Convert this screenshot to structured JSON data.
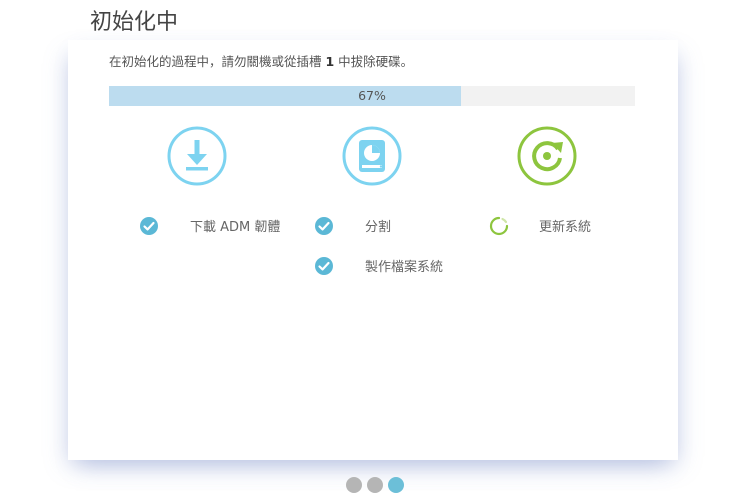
{
  "page": {
    "title": "初始化中",
    "description_pre": "在初始化的過程中，請勿關機或從插槽 ",
    "description_num": "1",
    "description_post": " 中拔除硬碟。"
  },
  "progress": {
    "percent": 67,
    "label": "67%"
  },
  "stages": [
    {
      "icon": "download-icon",
      "color": "#7dd3f0"
    },
    {
      "icon": "disk-partition-icon",
      "color": "#7dd3f0"
    },
    {
      "icon": "refresh-icon",
      "color": "#8dc53e"
    }
  ],
  "steps": {
    "download": {
      "label": "下載 ADM 韌體",
      "status": "done"
    },
    "partition": {
      "label": "分割",
      "status": "done"
    },
    "update": {
      "label": "更新系統",
      "status": "in-progress"
    },
    "filesystem": {
      "label": "製作檔案系統",
      "status": "done"
    }
  },
  "pagination": {
    "total": 3,
    "active": 3
  },
  "colors": {
    "check": "#5bb8d6",
    "accent": "#7dd3f0",
    "green": "#8dc53e",
    "bar": "#bcdcef"
  }
}
